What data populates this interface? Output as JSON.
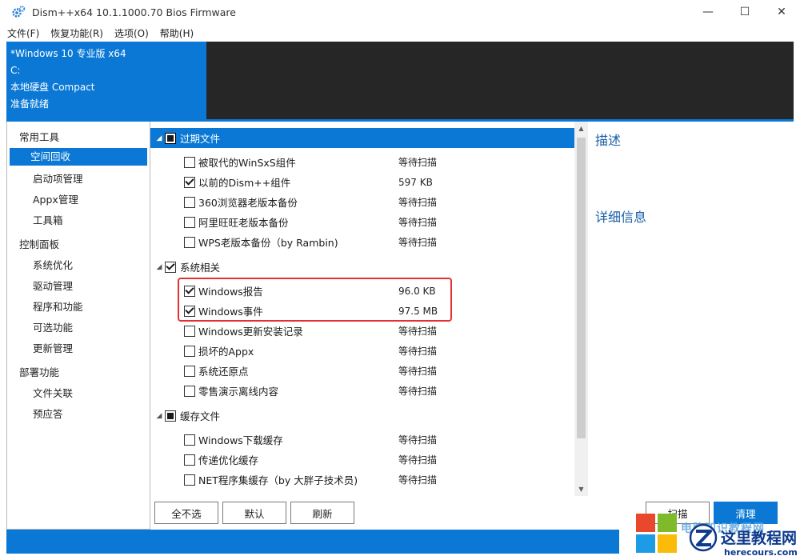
{
  "window": {
    "title": "Dism++x64 10.1.1000.70 Bios Firmware",
    "minimize": "—",
    "maximize": "☐",
    "close": "✕"
  },
  "menu": [
    "文件(F)",
    "恢复功能(R)",
    "选项(O)",
    "帮助(H)"
  ],
  "info": {
    "os": "*Windows 10 专业版 x64",
    "drive": "C:",
    "disk": "本地硬盘 Compact",
    "status": "准备就绪"
  },
  "nav": {
    "group1": "常用工具",
    "space_cleanup": "空间回收",
    "startup": "启动项管理",
    "appx": "Appx管理",
    "toolbox": "工具箱",
    "group2": "控制面板",
    "sys_opt": "系统优化",
    "driver": "驱动管理",
    "programs": "程序和功能",
    "optional": "可选功能",
    "updates": "更新管理",
    "group3": "部署功能",
    "file_assoc": "文件关联",
    "preanswer": "预应答"
  },
  "tree": {
    "g1": {
      "label": "过期文件"
    },
    "i1": {
      "label": "被取代的WinSxS组件",
      "status": "等待扫描"
    },
    "i2": {
      "label": "以前的Dism++组件",
      "status": "597 KB"
    },
    "i3": {
      "label": "360浏览器老版本备份",
      "status": "等待扫描"
    },
    "i4": {
      "label": "阿里旺旺老版本备份",
      "status": "等待扫描"
    },
    "i5": {
      "label": "WPS老版本备份（by Rambin)",
      "status": "等待扫描"
    },
    "g2": {
      "label": "系统相关"
    },
    "i6": {
      "label": "Windows报告",
      "status": "96.0 KB"
    },
    "i7": {
      "label": "Windows事件",
      "status": "97.5 MB"
    },
    "i8": {
      "label": "Windows更新安装记录",
      "status": "等待扫描"
    },
    "i9": {
      "label": "损坏的Appx",
      "status": "等待扫描"
    },
    "i10": {
      "label": "系统还原点",
      "status": "等待扫描"
    },
    "i11": {
      "label": "零售演示离线内容",
      "status": "等待扫描"
    },
    "g3": {
      "label": "缓存文件"
    },
    "i12": {
      "label": "Windows下载缓存",
      "status": "等待扫描"
    },
    "i13": {
      "label": "传递优化缓存",
      "status": "等待扫描"
    },
    "i14": {
      "label": "NET程序集缓存（by 大胖子技术员)",
      "status": "等待扫描"
    }
  },
  "desc": {
    "title": "描述",
    "details": "详细信息"
  },
  "buttons": {
    "deselect_all": "全不选",
    "default": "默认",
    "refresh": "刷新",
    "scan": "扫描",
    "clean": "清理"
  },
  "watermark": {
    "faded": "电脑知识教程网",
    "name": "这里教程网",
    "url": "herecours.com"
  },
  "colors": {
    "accent": "#0a78d4",
    "dark_band": "#262626",
    "highlight": "#e43030"
  }
}
